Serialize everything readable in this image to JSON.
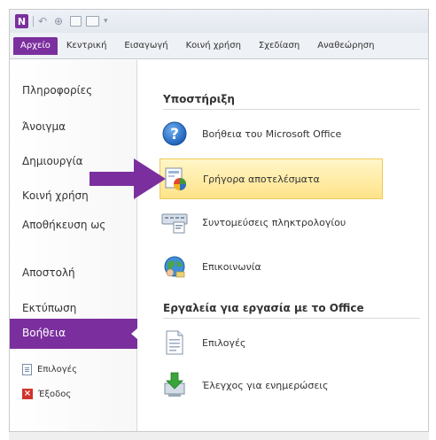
{
  "app": {
    "logo_letter": "N"
  },
  "colors": {
    "accent": "#7b2f9e",
    "highlight": "#ffe389",
    "highlight_border": "#f0c95b",
    "arrow": "#7b2f9e"
  },
  "ribbon": {
    "tabs": [
      "Αρχείο",
      "Κεντρική",
      "Εισαγωγή",
      "Κοινή χρήση",
      "Σχεδίαση",
      "Αναθεώρηση"
    ]
  },
  "nav": {
    "items": [
      "Πληροφορίες",
      "Άνοιγμα",
      "Δημιουργία",
      "Κοινή χρήση",
      "Αποθήκευση ως",
      "Αποστολή",
      "Εκτύπωση"
    ],
    "selected": "Βοήθεια",
    "small_items": [
      "Επιλογές",
      "Έξοδος"
    ]
  },
  "main": {
    "support_title": "Υποστήριξη",
    "support_items": [
      {
        "label": "Βοήθεια του Microsoft Office",
        "icon": "help-icon"
      },
      {
        "label": "Γρήγορα αποτελέσματα",
        "icon": "quick-results-icon"
      },
      {
        "label": "Συντομεύσεις πληκτρολογίου",
        "icon": "keyboard-shortcuts-icon"
      },
      {
        "label": "Επικοινωνία",
        "icon": "contact-globe-icon"
      }
    ],
    "tools_title": "Εργαλεία για εργασία με το Office",
    "tools_items": [
      {
        "label": "Επιλογές",
        "icon": "options-document-icon"
      },
      {
        "label": "Έλεγχος για ενημερώσεις",
        "icon": "check-updates-icon"
      }
    ]
  }
}
